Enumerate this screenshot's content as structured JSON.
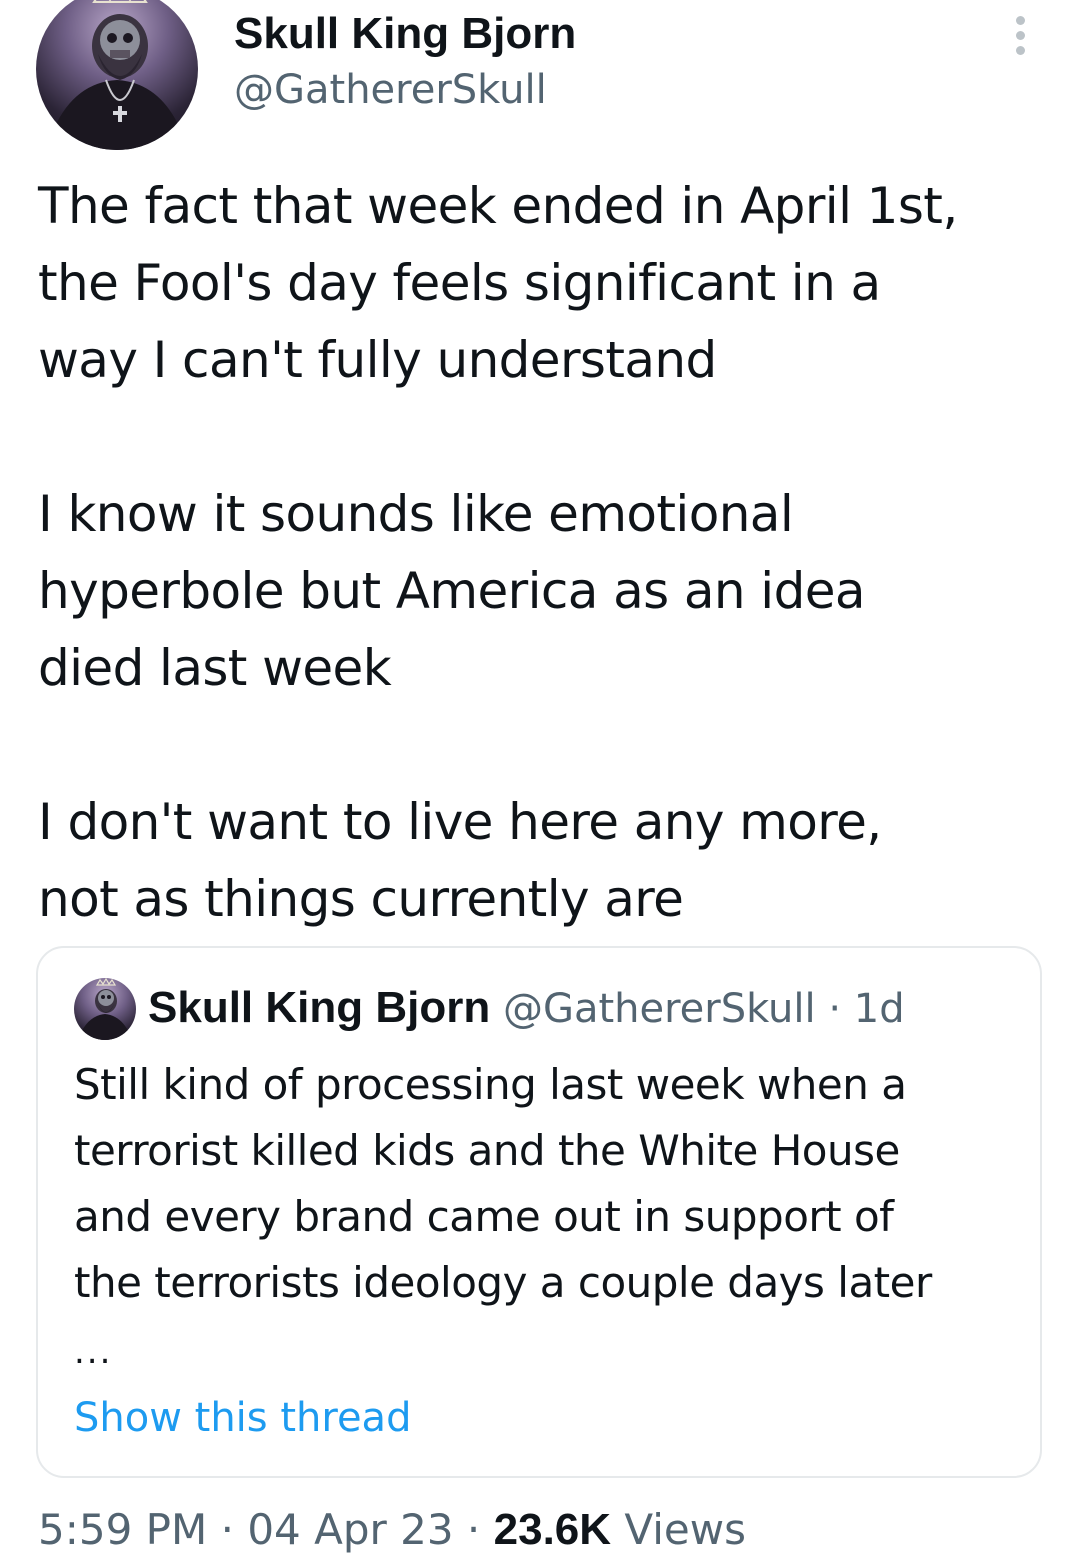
{
  "author": {
    "display_name": "Skull King Bjorn",
    "handle": "@GathererSkull",
    "avatar_icon": "profile-avatar"
  },
  "more_icon": "more-vertical-icon",
  "tweet": {
    "paragraphs": [
      "The fact that week ended in April 1st,\nthe Fool's day feels significant in a\nway I can't fully understand",
      "I know it sounds like emotional\nhyperbole but America as an idea\ndied last week",
      "I don't want to live here any more,\nnot as things currently are"
    ]
  },
  "quote": {
    "display_name": "Skull King Bjorn",
    "handle": "@GathererSkull",
    "separator": "·",
    "time": "1d",
    "text": "Still kind of processing last week when a\nterrorist killed kids and the White House\nand every brand came out in support of\nthe terrorists ideology a couple days later",
    "ellipsis": "...",
    "show_thread": "Show this thread"
  },
  "meta": {
    "time": "5:59 PM",
    "sep1": "·",
    "date": "04 Apr 23",
    "sep2": "·",
    "views_count": "23.6K",
    "views_label": "Views"
  },
  "colors": {
    "text": "#0f1419",
    "secondary": "#536471",
    "link": "#1d9bf0",
    "border": "#e6e9eb"
  }
}
